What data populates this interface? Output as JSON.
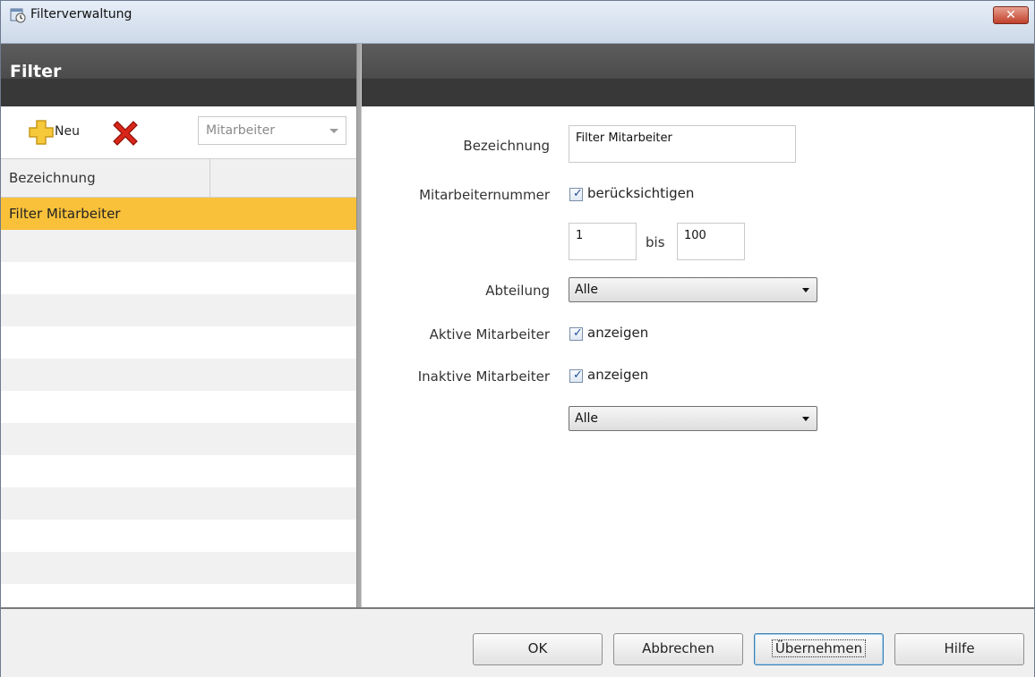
{
  "window": {
    "title": "Filterverwaltung",
    "close_glyph": "✕"
  },
  "left": {
    "header_title": "Filter",
    "toolbar": {
      "new_label": "Neu",
      "combo_value": "Mitarbeiter"
    },
    "grid": {
      "column_header": "Bezeichnung",
      "rows": [
        "Filter Mitarbeiter"
      ]
    }
  },
  "form": {
    "bezeichnung": {
      "label": "Bezeichnung",
      "value": "Filter Mitarbeiter"
    },
    "mitarbeiternummer": {
      "label": "Mitarbeiternummer",
      "checked": true,
      "check_label": "berücksichtigen",
      "from": "1",
      "to_label": "bis",
      "to": "100"
    },
    "abteilung": {
      "label": "Abteilung",
      "value": "Alle"
    },
    "aktive": {
      "label": "Aktive Mitarbeiter",
      "checked": true,
      "check_label": "anzeigen"
    },
    "inaktive": {
      "label": "Inaktive Mitarbeiter",
      "checked": true,
      "check_label": "anzeigen",
      "select_value": "Alle"
    }
  },
  "footer": {
    "ok": "OK",
    "cancel": "Abbrechen",
    "apply": "Übernehmen",
    "help": "Hilfe"
  },
  "colors": {
    "selection": "#f9c13a",
    "header_dark": "#383838",
    "close_red": "#c0402a"
  },
  "icons": {
    "app": "filter-app-icon",
    "new": "plus-icon",
    "delete": "delete-x-icon"
  }
}
